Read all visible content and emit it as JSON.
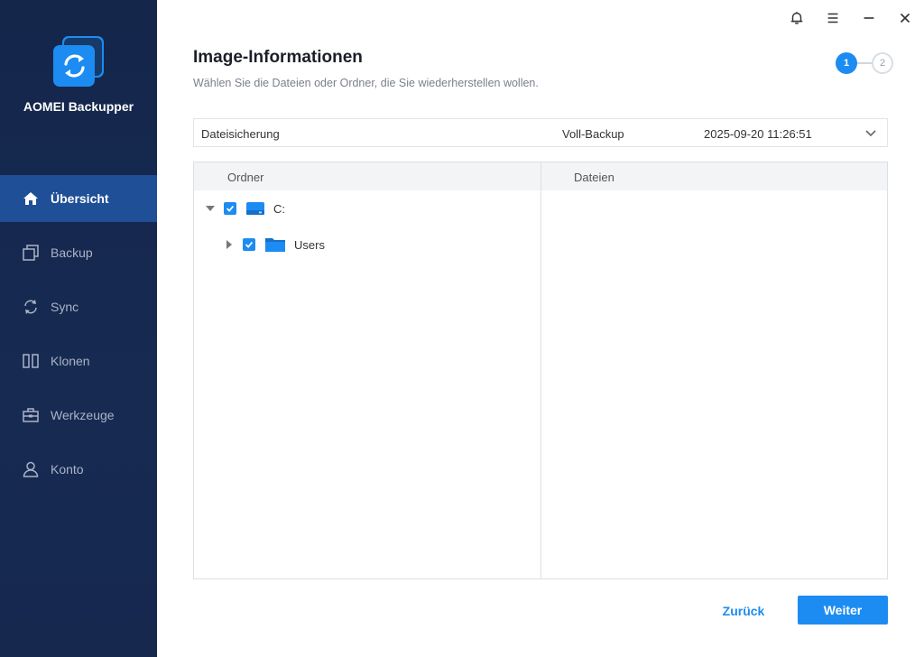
{
  "app": {
    "name": "AOMEI Backupper"
  },
  "sidebar": {
    "items": [
      {
        "label": "Übersicht",
        "icon": "home-icon",
        "active": true
      },
      {
        "label": "Backup",
        "icon": "backup-icon"
      },
      {
        "label": "Sync",
        "icon": "sync-icon"
      },
      {
        "label": "Klonen",
        "icon": "clone-icon"
      },
      {
        "label": "Werkzeuge",
        "icon": "toolbox-icon"
      },
      {
        "label": "Konto",
        "icon": "user-icon"
      }
    ]
  },
  "titlebar": {
    "icons": [
      "bell-icon",
      "menu-icon",
      "minimize-icon",
      "close-icon"
    ]
  },
  "header": {
    "title": "Image-Informationen",
    "subtitle": "Wählen Sie die Dateien oder Ordner, die Sie wiederherstellen wollen."
  },
  "stepper": {
    "steps": [
      "1",
      "2"
    ],
    "current": 1
  },
  "backup": {
    "name": "Dateisicherung",
    "type": "Voll-Backup",
    "date": "2025-09-20 11:26:51"
  },
  "browser": {
    "folders_header": "Ordner",
    "files_header": "Dateien",
    "tree": [
      {
        "label": "C:",
        "expanded": true,
        "checked": true,
        "icon": "drive-icon"
      },
      {
        "label": "Users",
        "expanded": false,
        "checked": true,
        "icon": "folder-icon"
      }
    ]
  },
  "footer": {
    "back_label": "Zurück",
    "next_label": "Weiter"
  },
  "colors": {
    "accent": "#1c8cf2",
    "sidebar": "#172a52",
    "sidebar_active": "#1f4f97"
  }
}
